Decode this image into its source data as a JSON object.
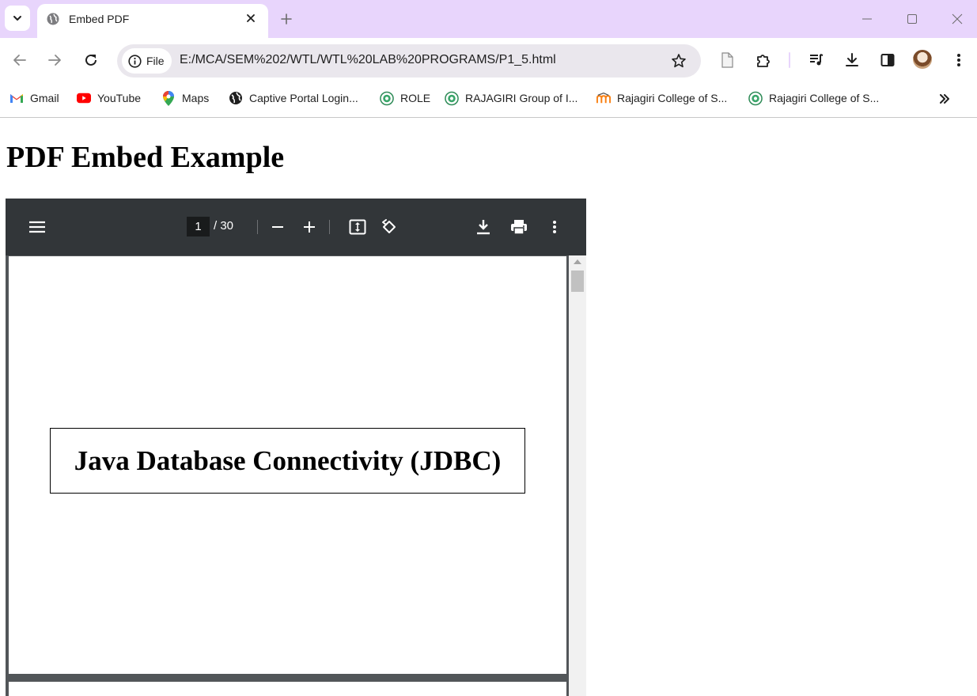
{
  "browser": {
    "tab": {
      "title": "Embed PDF"
    },
    "address": {
      "scheme_label": "File",
      "url": "E:/MCA/SEM%202/WTL/WTL%20LAB%20PROGRAMS/P1_5.html"
    },
    "bookmarks": [
      {
        "label": "Gmail",
        "icon": "gmail-icon"
      },
      {
        "label": "YouTube",
        "icon": "youtube-icon"
      },
      {
        "label": "Maps",
        "icon": "maps-icon"
      },
      {
        "label": "Captive Portal Login...",
        "icon": "globe-icon"
      },
      {
        "label": "ROLE",
        "icon": "rajagiri-seal-icon"
      },
      {
        "label": "RAJAGIRI Group of I...",
        "icon": "rajagiri-seal-icon"
      },
      {
        "label": "Rajagiri College of S...",
        "icon": "moodle-icon"
      },
      {
        "label": "Rajagiri College of S...",
        "icon": "rajagiri-seal-icon"
      }
    ]
  },
  "page": {
    "title": "PDF Embed Example"
  },
  "pdf_viewer": {
    "current_page": "1",
    "total_pages": "/ 30",
    "page_heading": "Java Database Connectivity (JDBC)"
  },
  "colors": {
    "tabstrip": "#e8d5fc",
    "omnibox": "#eae7ed",
    "pdf_toolbar": "#323639",
    "pdf_background": "#525659"
  }
}
